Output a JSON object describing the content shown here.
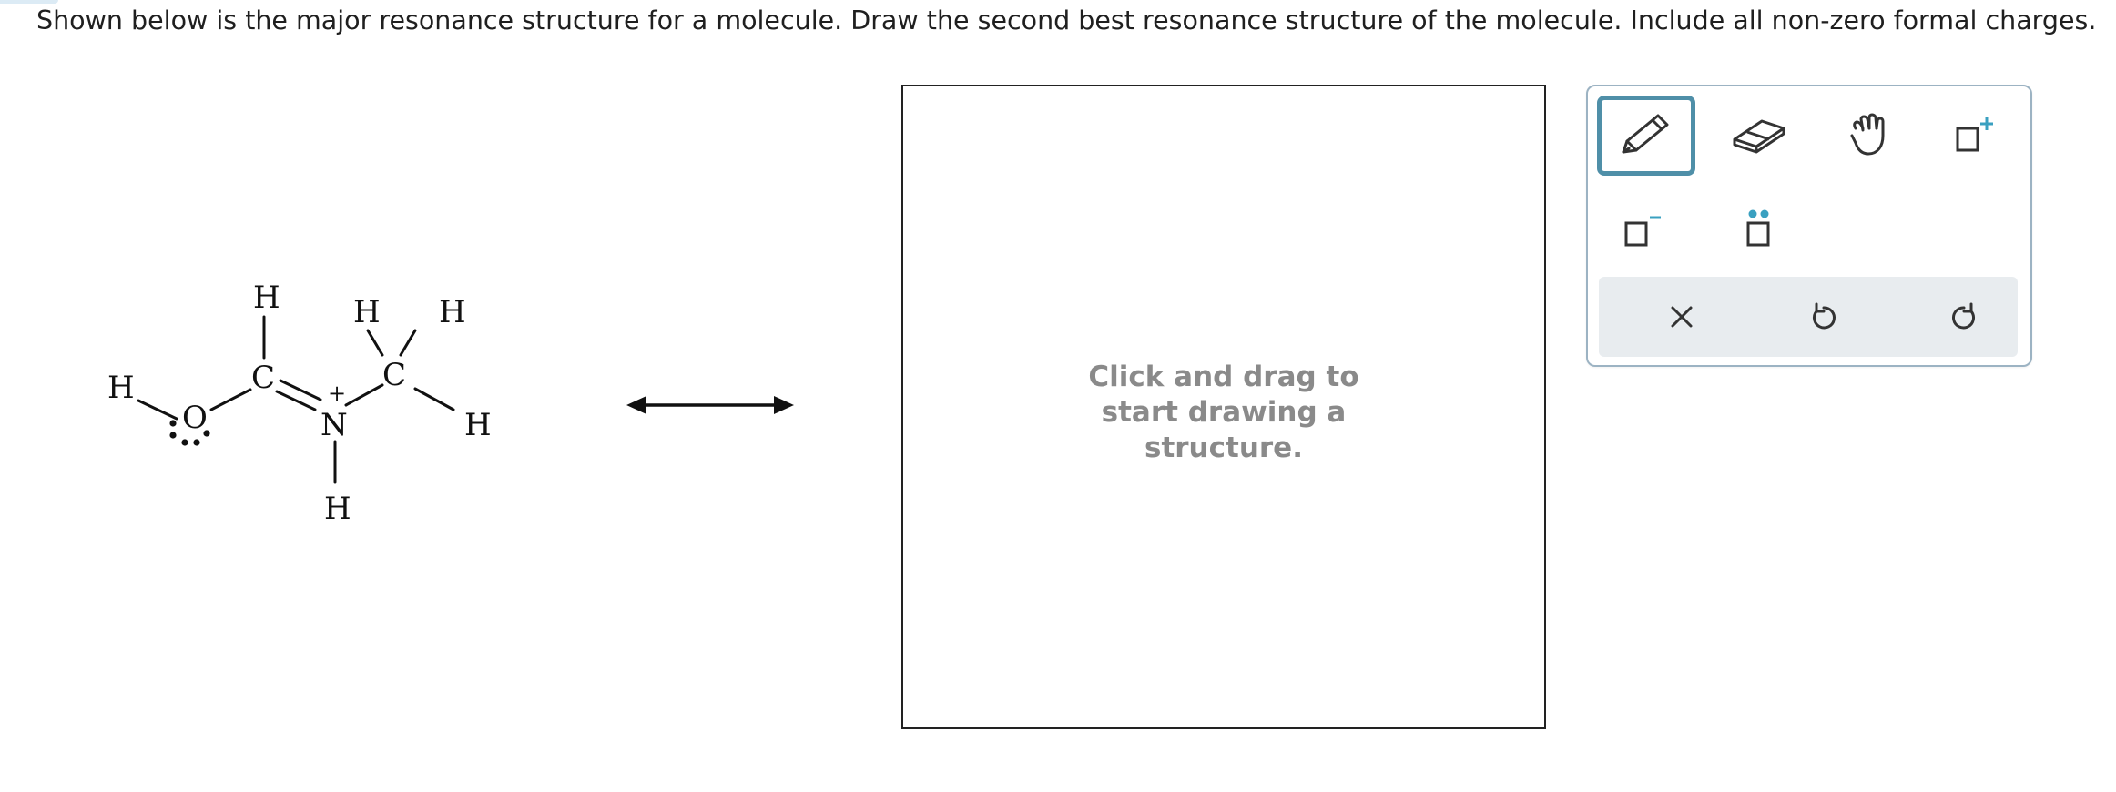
{
  "prompt": "Shown below is the major resonance structure for a molecule. Draw the second best resonance structure of the molecule. Include all non-zero formal charges.",
  "molecule": {
    "atoms": {
      "h_oh": "H",
      "o": "O",
      "c1": "C",
      "h_c1": "H",
      "n": "N",
      "n_charge": "+",
      "h_n": "H",
      "c2": "C",
      "h_c2a": "H",
      "h_c2b": "H",
      "h_c2c": "H"
    }
  },
  "canvas": {
    "hint_line1": "Click and drag to",
    "hint_line2": "start drawing a",
    "hint_line3": "structure."
  },
  "toolbar": {
    "tools": [
      "pencil-icon",
      "eraser-icon",
      "hand-icon",
      "positive-charge-icon",
      "negative-charge-icon",
      "lone-pair-icon"
    ],
    "actions": [
      "clear-icon",
      "undo-icon",
      "redo-icon"
    ],
    "accent_color": "#4f8fa8",
    "lone_pair_color": "#3aa0c0"
  }
}
